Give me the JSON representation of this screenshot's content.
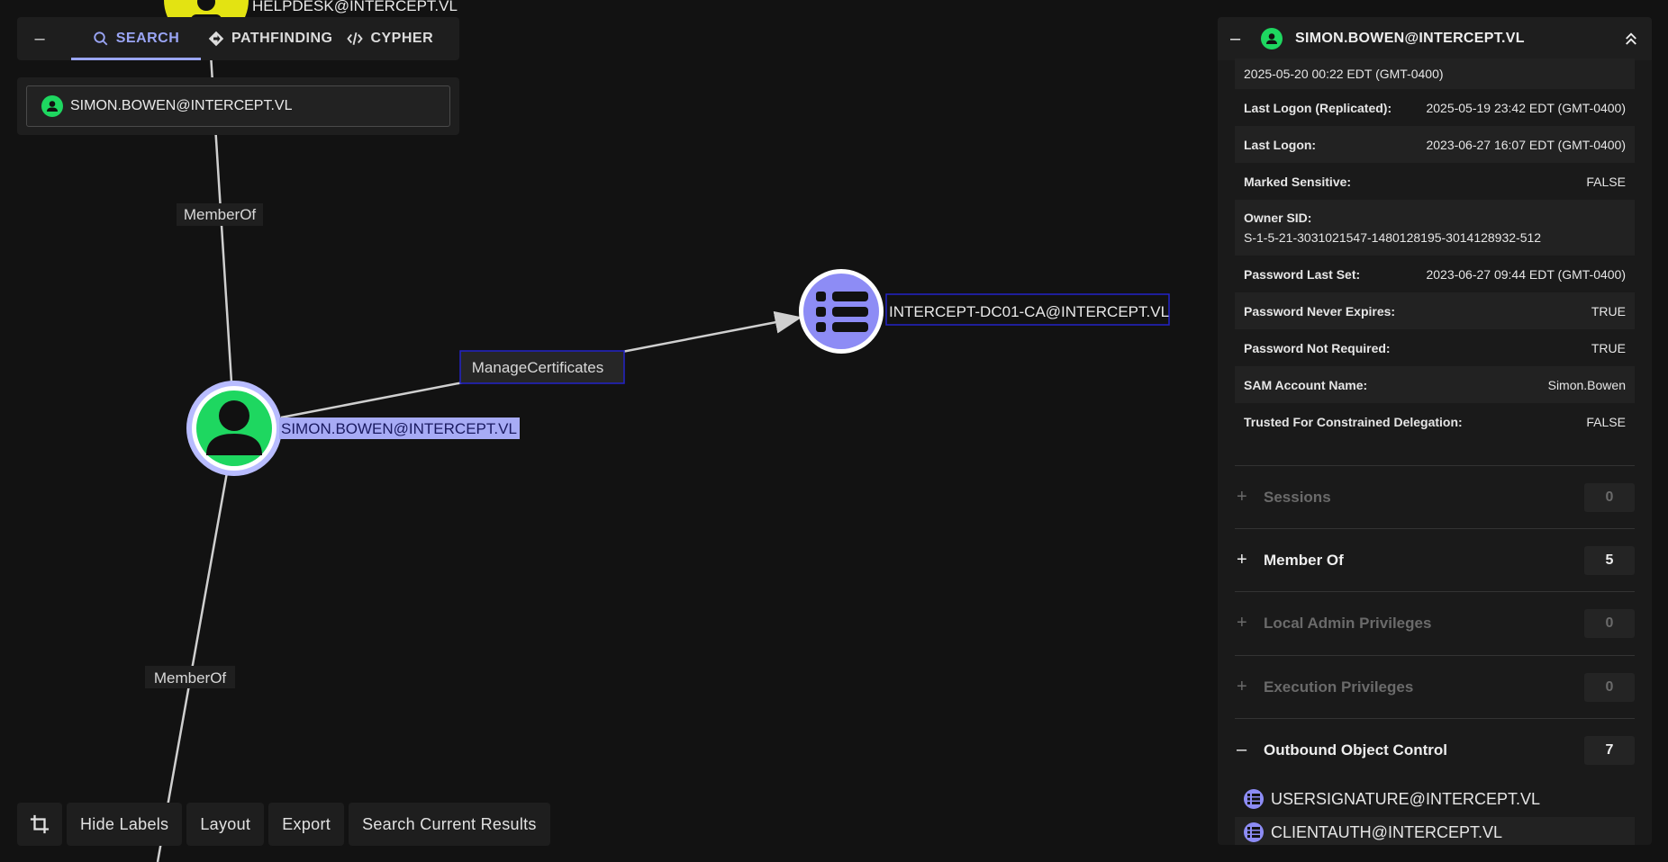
{
  "graph": {
    "nodes": {
      "helpdesk": "HELPDESK@INTERCEPT.VL",
      "user": "SIMON.BOWEN@INTERCEPT.VL",
      "ca": "INTERCEPT-DC01-CA@INTERCEPT.VL"
    },
    "edges": {
      "member_of_top": "MemberOf",
      "manage_certs": "ManageCertificates",
      "member_of_bottom": "MemberOf"
    },
    "colors": {
      "user_node": "#1ed760",
      "group_node": "#e3e312",
      "ca_node": "#8d8cf5",
      "selected_ring": "#b8bcff"
    }
  },
  "search_panel": {
    "collapse": "–",
    "tabs": [
      {
        "label": "SEARCH",
        "icon": "search-icon",
        "active": true
      },
      {
        "label": "PATHFINDING",
        "icon": "diamond-route-icon",
        "active": false
      },
      {
        "label": "CYPHER",
        "icon": "code-icon",
        "active": false
      }
    ],
    "search_value": "SIMON.BOWEN@INTERCEPT.VL"
  },
  "toolbar": {
    "hide_labels": "Hide Labels",
    "layout": "Layout",
    "export": "Export",
    "search_results": "Search Current Results"
  },
  "details": {
    "title": "SIMON.BOWEN@INTERCEPT.VL",
    "collapse": "–",
    "top_value": "2025-05-20 00:22 EDT (GMT-0400)",
    "props": [
      {
        "label": "Last Logon (Replicated):",
        "value": "2025-05-19 23:42 EDT (GMT-0400)"
      },
      {
        "label": "Last Logon:",
        "value": "2023-06-27 16:07 EDT (GMT-0400)"
      },
      {
        "label": "Marked Sensitive:",
        "value": "FALSE"
      },
      {
        "label": "Owner SID:",
        "value": "S-1-5-21-3031021547-1480128195-3014128932-512"
      },
      {
        "label": "Password Last Set:",
        "value": "2023-06-27 09:44 EDT (GMT-0400)"
      },
      {
        "label": "Password Never Expires:",
        "value": "TRUE"
      },
      {
        "label": "Password Not Required:",
        "value": "TRUE"
      },
      {
        "label": "SAM Account Name:",
        "value": "Simon.Bowen"
      },
      {
        "label": "Trusted For Constrained Delegation:",
        "value": "FALSE"
      }
    ],
    "sections": [
      {
        "toggle": "+",
        "label": "Sessions",
        "count": "0"
      },
      {
        "toggle": "+",
        "label": "Member Of",
        "count": "5"
      },
      {
        "toggle": "+",
        "label": "Local Admin Privileges",
        "count": "0"
      },
      {
        "toggle": "+",
        "label": "Execution Privileges",
        "count": "0"
      },
      {
        "toggle": "–",
        "label": "Outbound Object Control",
        "count": "7"
      }
    ],
    "outbound_items": [
      "USERSIGNATURE@INTERCEPT.VL",
      "CLIENTAUTH@INTERCEPT.VL"
    ]
  }
}
